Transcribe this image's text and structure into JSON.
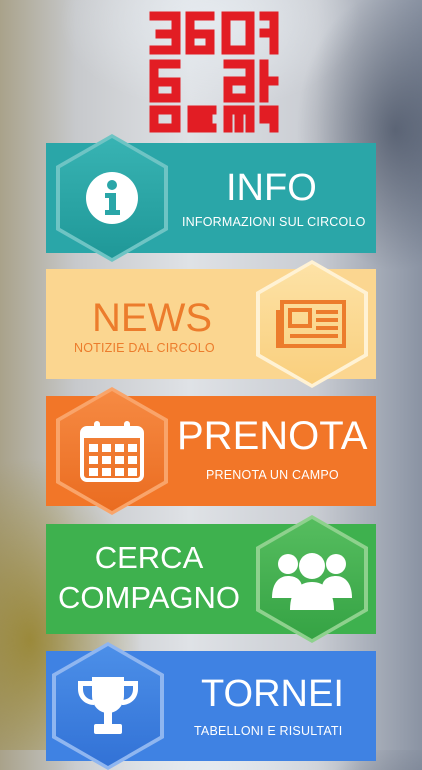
{
  "logo": {
    "alt": "360 Game"
  },
  "menu": [
    {
      "key": "info",
      "title": "INFO",
      "subtitle": "INFORMAZIONI SUL CIRCOLO",
      "icon": "info-icon",
      "color": "#2aa6a8"
    },
    {
      "key": "news",
      "title": "NEWS",
      "subtitle": "NOTIZIE DAL CIRCOLO",
      "icon": "newspaper-icon",
      "color": "#fbd690"
    },
    {
      "key": "prenota",
      "title": "PRENOTA",
      "subtitle": "PRENOTA UN CAMPO",
      "icon": "calendar-icon",
      "color": "#f27628"
    },
    {
      "key": "cerca",
      "title_line1": "CERCA",
      "title_line2": "COMPAGNO",
      "icon": "group-icon",
      "color": "#3eb14e"
    },
    {
      "key": "tornei",
      "title": "TORNEI",
      "subtitle": "TABELLONI E RISULTATI",
      "icon": "trophy-icon",
      "color": "#3f82e3"
    }
  ]
}
